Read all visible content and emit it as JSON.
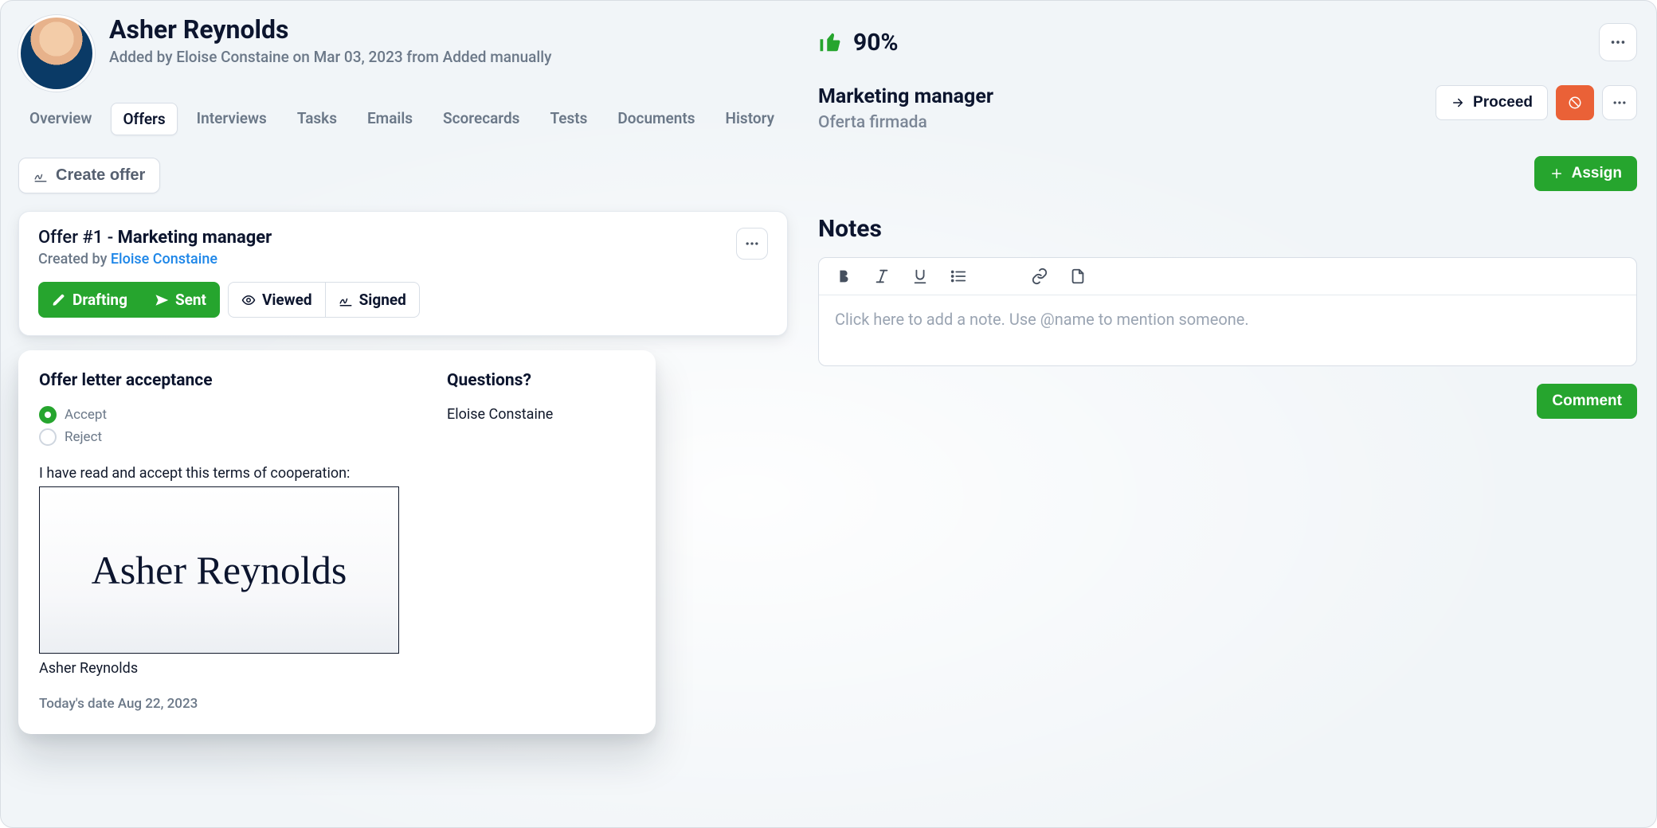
{
  "person": {
    "name": "Asher Reynolds",
    "added_line": "Added by Eloise Constaine on Mar 03, 2023 from Added manually"
  },
  "tabs": [
    "Overview",
    "Offers",
    "Interviews",
    "Tasks",
    "Emails",
    "Scorecards",
    "Tests",
    "Documents",
    "History"
  ],
  "active_tab_index": 1,
  "create_offer_label": "Create offer",
  "offer": {
    "prefix": "Offer #1 - ",
    "role": "Marketing manager",
    "created_by_label": "Created by ",
    "created_by_name": "Eloise Constaine",
    "stages": {
      "drafting": "Drafting",
      "sent": "Sent",
      "viewed": "Viewed",
      "signed": "Signed"
    }
  },
  "acceptance": {
    "heading": "Offer letter acceptance",
    "options": {
      "accept": "Accept",
      "reject": "Reject"
    },
    "selected": "accept",
    "terms_line": "I have read and accept this terms of cooperation:",
    "signature_text": "Asher Reynolds",
    "signer_name": "Asher Reynolds",
    "date_line": "Today's date Aug 22, 2023",
    "questions_heading": "Questions?",
    "contact": "Eloise Constaine"
  },
  "right": {
    "score": "90%",
    "role_title": "Marketing manager",
    "role_subtitle": "Oferta firmada",
    "proceed_label": "Proceed",
    "assign_label": "Assign",
    "notes_heading": "Notes",
    "note_placeholder": "Click here to add a note. Use @name to mention someone.",
    "comment_label": "Comment"
  }
}
